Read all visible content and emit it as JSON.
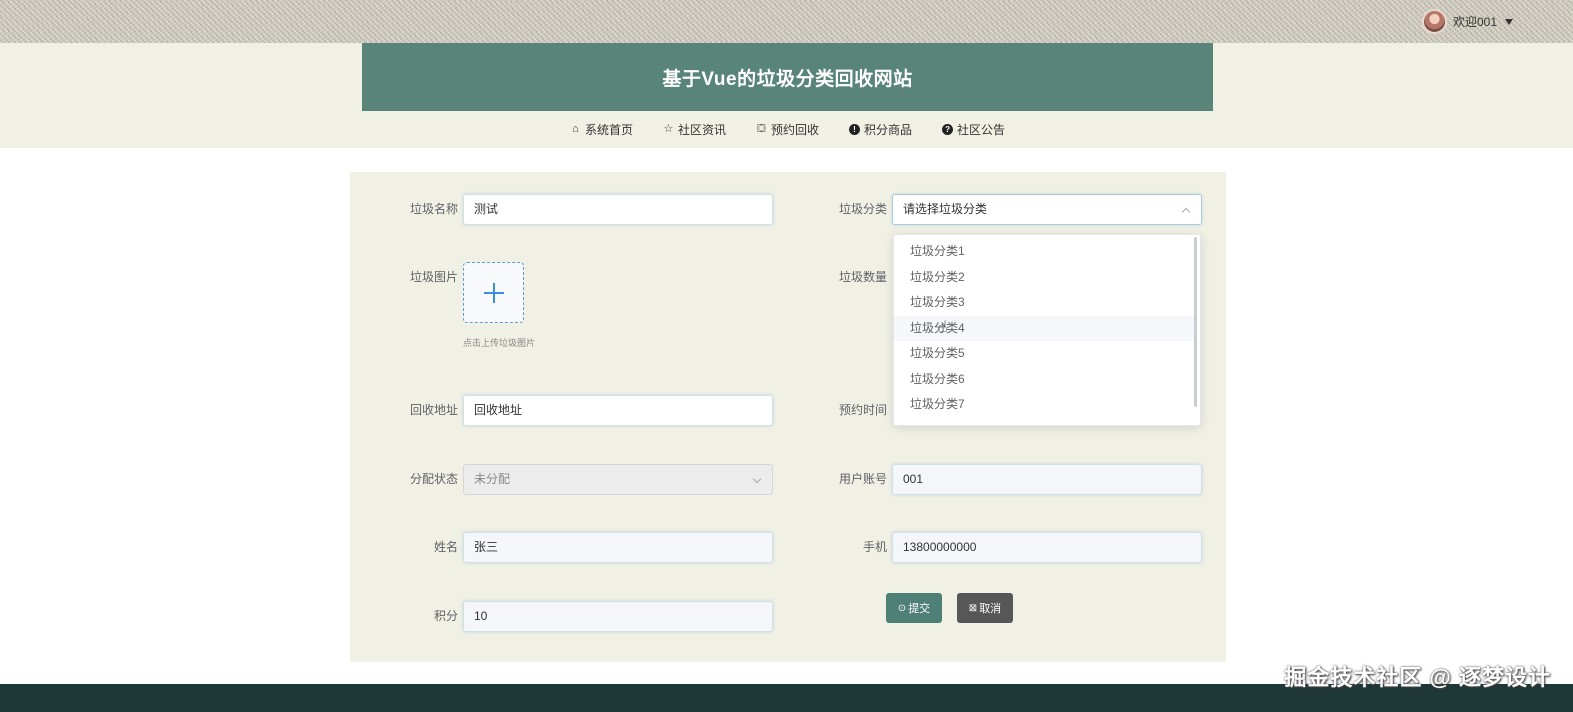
{
  "user": {
    "welcome": "欢迎001"
  },
  "header": {
    "title": "基于Vue的垃圾分类回收网站"
  },
  "nav": [
    {
      "label": "系统首页",
      "icon": "home-icon"
    },
    {
      "label": "社区资讯",
      "icon": "star-icon"
    },
    {
      "label": "预约回收",
      "icon": "bag-icon"
    },
    {
      "label": "积分商品",
      "icon": "info-icon"
    },
    {
      "label": "社区公告",
      "icon": "question-icon"
    }
  ],
  "form": {
    "name_label": "垃圾名称",
    "name_value": "测试",
    "category_label": "垃圾分类",
    "category_placeholder": "请选择垃圾分类",
    "image_label": "垃圾图片",
    "image_hint": "点击上传垃圾图片",
    "quantity_label": "垃圾数量",
    "address_label": "回收地址",
    "address_value": "回收地址",
    "time_label": "预约时间",
    "status_label": "分配状态",
    "status_value": "未分配",
    "account_label": "用户账号",
    "account_value": "001",
    "person_label": "姓名",
    "person_value": "张三",
    "phone_label": "手机",
    "phone_value": "13800000000",
    "points_label": "积分",
    "points_value": "10",
    "submit_label": "提交",
    "cancel_label": "取消"
  },
  "dropdown": {
    "options": [
      "垃圾分类1",
      "垃圾分类2",
      "垃圾分类3",
      "垃圾分类4",
      "垃圾分类5",
      "垃圾分类6",
      "垃圾分类7"
    ]
  },
  "watermark": "掘金技术社区 @ 逐梦设计",
  "colors": {
    "primary": "#588479",
    "panel": "#f0f0e5",
    "footer": "#1e3837",
    "cancel": "#575757"
  }
}
